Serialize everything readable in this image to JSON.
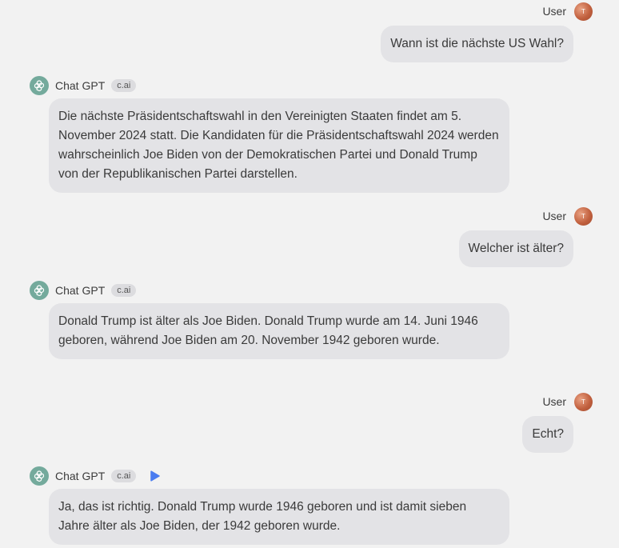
{
  "messages": [
    {
      "role": "user",
      "name": "User",
      "avatar_initial": "T",
      "text": "Wann ist die nächste US Wahl?"
    },
    {
      "role": "bot",
      "name": "Chat GPT",
      "tag": "c.ai",
      "text": "Die nächste Präsidentschaftswahl in den Vereinigten Staaten findet am 5. November 2024 statt. Die Kandidaten für die Präsidentschaftswahl 2024 werden wahrscheinlich Joe Biden von der Demokratischen Partei und Donald Trump von der Republikanischen Partei darstellen."
    },
    {
      "role": "user",
      "name": "User",
      "avatar_initial": "T",
      "text": "Welcher ist älter?"
    },
    {
      "role": "bot",
      "name": "Chat GPT",
      "tag": "c.ai",
      "text": "Donald Trump ist älter als Joe Biden. Donald Trump wurde am 14. Juni 1946 geboren, während Joe Biden am 20. November 1942 geboren wurde."
    },
    {
      "role": "user",
      "name": "User",
      "avatar_initial": "T",
      "text": "Echt?"
    },
    {
      "role": "bot",
      "name": "Chat GPT",
      "tag": "c.ai",
      "text": "Ja, das ist richtig. Donald Trump wurde 1946 geboren und ist damit sieben Jahre älter als Joe Biden, der 1942 geboren wurde."
    }
  ],
  "colors": {
    "background": "#f2f2f2",
    "bubble": "#e3e3e6",
    "bot_logo": "#74aa9c",
    "play_accent": "#4a7cf0"
  },
  "icons": {
    "bot_logo": "openai-logo-icon",
    "play": "play-icon"
  }
}
